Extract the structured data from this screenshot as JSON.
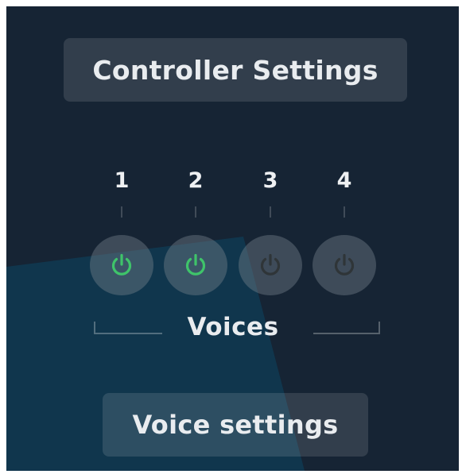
{
  "controller_button": {
    "label": "Controller Settings"
  },
  "voice_button": {
    "label": "Voice settings"
  },
  "voices": {
    "group_label": "Voices",
    "items": [
      {
        "number": "1",
        "enabled": true
      },
      {
        "number": "2",
        "enabled": true
      },
      {
        "number": "3",
        "enabled": false
      },
      {
        "number": "4",
        "enabled": false
      }
    ]
  },
  "colors": {
    "background": "#162434",
    "accent_shape": "#0f3a52",
    "power_on": "#3fc46a",
    "power_off": "#2f3538",
    "text": "#e9ecef"
  },
  "icons": {
    "power": "power-icon"
  }
}
